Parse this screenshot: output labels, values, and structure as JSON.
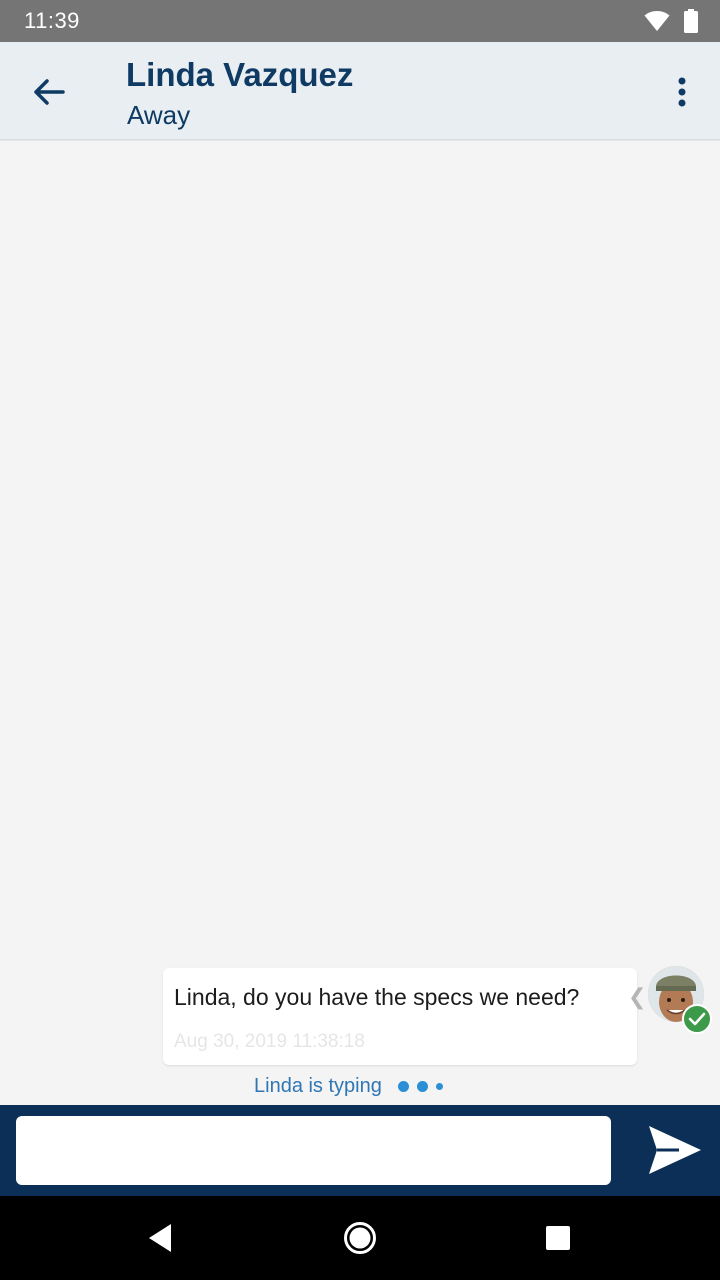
{
  "status_bar": {
    "time": "11:39",
    "icons": [
      "wifi-icon",
      "battery-icon"
    ]
  },
  "header": {
    "back_icon": "arrow-left-icon",
    "contact_name": "Linda Vazquez",
    "contact_status": "Away",
    "menu_icon": "more-vertical-icon"
  },
  "messages": [
    {
      "text": "Linda, do you have the specs we need?",
      "timestamp": "Aug 30, 2019 11:38:18",
      "status_icon": "check-icon",
      "avatar": "user-avatar"
    }
  ],
  "typing_indicator": {
    "text": "Linda is typing"
  },
  "composer": {
    "value": "",
    "placeholder": "",
    "send_icon": "send-icon"
  },
  "colors": {
    "header_bg": "#e9eef2",
    "header_text": "#0e3a63",
    "composer_bg": "#0b2f57",
    "typing_text": "#2f76b5",
    "status_badge": "#3d9a4b"
  },
  "nav": {
    "icons": [
      "back-triangle-icon",
      "home-circle-icon",
      "recents-square-icon"
    ]
  }
}
